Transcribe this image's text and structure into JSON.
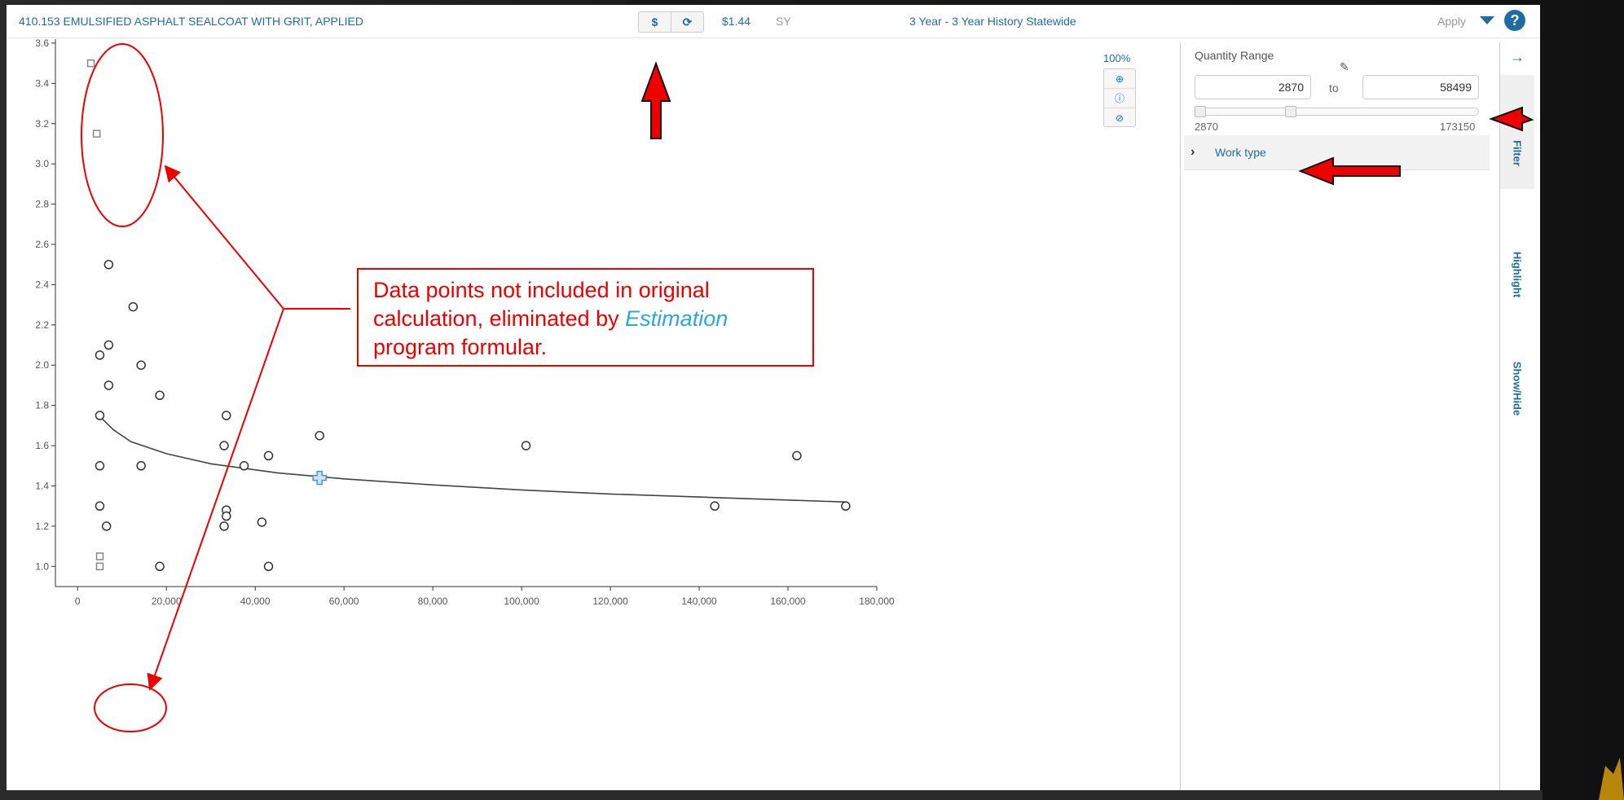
{
  "header": {
    "item_title": "410.153 EMULSIFIED ASPHALT SEALCOAT WITH GRIT, APPLIED",
    "price_button_label": "$",
    "refresh_icon": "refresh-icon",
    "price": "$1.44",
    "unit": "SY",
    "history": "3 Year - 3 Year History Statewide",
    "apply_label": "Apply",
    "help_label": "?"
  },
  "zoom": {
    "percent": "100%",
    "icons": [
      "zoom-in-icon",
      "info-icon",
      "reset-icon"
    ]
  },
  "filter_panel": {
    "quantity_range_label": "Quantity Range",
    "min_value": "2870",
    "max_value": "58499",
    "to_label": "to",
    "slider_min": "2870",
    "slider_max": "173150",
    "work_type_label": "Work type"
  },
  "side_tabs": {
    "filter": "Filter",
    "highlight": "Highlight",
    "show_hide": "Show/Hide"
  },
  "annotation": {
    "line1": "Data points not included in original",
    "line2": "calculation, eliminated by ",
    "line2_em": "Estimation",
    "line3": "program formular."
  },
  "chart_data": {
    "type": "scatter",
    "xlim": [
      -5000,
      180000
    ],
    "ylim": [
      0.9,
      3.62
    ],
    "x_ticks": [
      0,
      20000,
      40000,
      60000,
      80000,
      100000,
      120000,
      140000,
      160000,
      180000
    ],
    "x_tick_labels": [
      "0",
      "20,000",
      "40,000",
      "60,000",
      "80,000",
      "100,000",
      "120,000",
      "140,000",
      "160,000",
      "180,000"
    ],
    "y_ticks": [
      1.0,
      1.2,
      1.4,
      1.6,
      1.8,
      2.0,
      2.2,
      2.4,
      2.6,
      2.8,
      3.0,
      3.2,
      3.4,
      3.6
    ],
    "y_tick_labels": [
      "1.0",
      "1.2",
      "1.4",
      "1.6",
      "1.8",
      "2.0",
      "2.2",
      "2.4",
      "2.6",
      "2.8",
      "3.0",
      "3.2",
      "3.4",
      "3.6"
    ],
    "grid": false,
    "series": [
      {
        "marker": "circle",
        "points": [
          [
            7000,
            2.5
          ],
          [
            12500,
            2.29
          ],
          [
            7000,
            2.1
          ],
          [
            5000,
            2.05
          ],
          [
            14300,
            2.0
          ],
          [
            7000,
            1.9
          ],
          [
            18500,
            1.85
          ],
          [
            5000,
            1.75
          ],
          [
            33500,
            1.75
          ],
          [
            54500,
            1.65
          ],
          [
            33000,
            1.6
          ],
          [
            101000,
            1.6
          ],
          [
            43000,
            1.55
          ],
          [
            162000,
            1.55
          ],
          [
            5000,
            1.5
          ],
          [
            14300,
            1.5
          ],
          [
            37500,
            1.5
          ],
          [
            5000,
            1.3
          ],
          [
            33500,
            1.28
          ],
          [
            33500,
            1.25
          ],
          [
            143500,
            1.3
          ],
          [
            173000,
            1.3
          ],
          [
            41500,
            1.22
          ],
          [
            6500,
            1.2
          ],
          [
            33000,
            1.2
          ],
          [
            18500,
            1.0
          ],
          [
            43000,
            1.0
          ]
        ]
      },
      {
        "marker": "square",
        "points": [
          [
            3000,
            3.5
          ],
          [
            4300,
            3.15
          ],
          [
            5000,
            1.05
          ],
          [
            5000,
            1.0
          ]
        ]
      },
      {
        "marker": "cross",
        "points": [
          [
            54500,
            1.44
          ]
        ]
      }
    ],
    "trendline": [
      [
        5000,
        1.745
      ],
      [
        8000,
        1.68
      ],
      [
        12000,
        1.62
      ],
      [
        20000,
        1.56
      ],
      [
        30000,
        1.51
      ],
      [
        45000,
        1.465
      ],
      [
        60000,
        1.435
      ],
      [
        80000,
        1.405
      ],
      [
        100000,
        1.38
      ],
      [
        120000,
        1.36
      ],
      [
        140000,
        1.345
      ],
      [
        160000,
        1.33
      ],
      [
        173000,
        1.32
      ]
    ],
    "colors": {
      "marker_circle": "#333333",
      "marker_square": "#888888",
      "trendline": "#444444",
      "cross": "#4a90d9"
    }
  },
  "colors": {
    "accent": "#1f6ca5",
    "annotation_red": "#e00000",
    "annotation_blue": "#2aa6e0"
  }
}
